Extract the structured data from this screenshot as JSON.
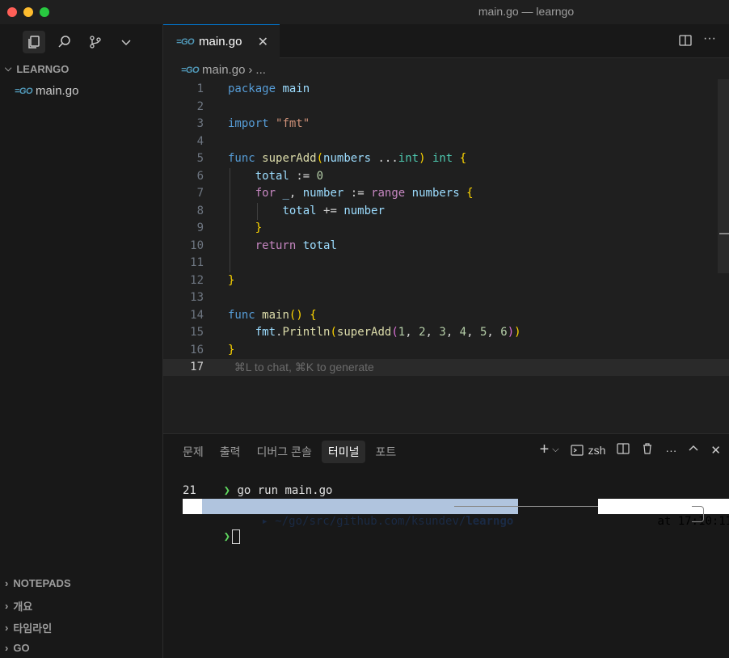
{
  "window": {
    "title": "main.go — learngo"
  },
  "sidebar": {
    "icons": [
      "files-icon",
      "search-icon",
      "source-control-icon",
      "chevron-down-icon"
    ],
    "explorer_title": "LEARNGO",
    "file": "main.go",
    "bottom_sections": [
      "NOTEPADS",
      "개요",
      "타임라인",
      "GO"
    ]
  },
  "editor": {
    "tab_label": "main.go",
    "breadcrumb_file": "main.go",
    "breadcrumb_more": "...",
    "hint": "⌘L to chat, ⌘K to generate",
    "lines": [
      "package main",
      "",
      "import \"fmt\"",
      "",
      "func superAdd(numbers ...int) int {",
      "    total := 0",
      "    for _, number := range numbers {",
      "        total += number",
      "    }",
      "    return total",
      "",
      "}",
      "",
      "func main() {",
      "    fmt.Println(superAdd(1, 2, 3, 4, 5, 6))",
      "}",
      ""
    ]
  },
  "panel": {
    "tabs": [
      "문제",
      "출력",
      "디버그 콘솔",
      "터미널",
      "포트"
    ],
    "active_tab": "터미널",
    "shell": "zsh",
    "terminal": {
      "command": "go run main.go",
      "output": "21",
      "path_prefix": "~/go/src/github.com/ksundev/",
      "path_dir": "learngo",
      "time": "at 17:10:11"
    }
  }
}
